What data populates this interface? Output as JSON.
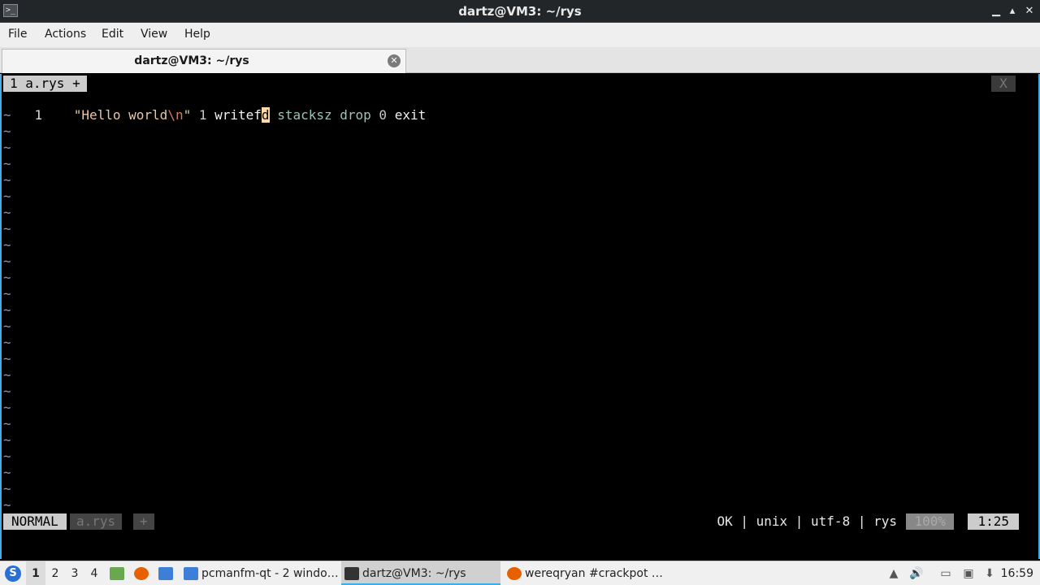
{
  "window": {
    "title": "dartz@VM3: ~/rys",
    "icon": "terminal-icon",
    "buttons": {
      "minimize": "▁",
      "maximize": "▴",
      "close": "✕"
    }
  },
  "menubar": {
    "items": [
      "File",
      "Actions",
      "Edit",
      "View",
      "Help"
    ]
  },
  "tabs": [
    {
      "label": "dartz@VM3: ~/rys",
      "close": "✕"
    }
  ],
  "vim": {
    "tabline": {
      "tab": "1 a.rys +",
      "close": "X"
    },
    "buffer": {
      "line_number": "1",
      "tokens": [
        {
          "text": " \"Hello world",
          "cls": "str"
        },
        {
          "text": "\\n",
          "cls": "esc"
        },
        {
          "text": "\" ",
          "cls": "str"
        },
        {
          "text": "1 ",
          "cls": "num"
        },
        {
          "text": "write",
          "cls": "kw"
        },
        {
          "text": "f",
          "cls": "kw"
        },
        {
          "text": "d",
          "cls": "cursor"
        },
        {
          "text": " stacksz drop ",
          "cls": "kw2"
        },
        {
          "text": "0 ",
          "cls": "num"
        },
        {
          "text": "exit",
          "cls": "kw"
        }
      ],
      "tilde": "~"
    },
    "statusline": {
      "mode": "NORMAL",
      "filename": "a.rys",
      "modified": "+",
      "info": "OK | unix | utf-8 | rys",
      "percent": "100%",
      "position": "1:25"
    }
  },
  "taskbar": {
    "workspaces": [
      "1",
      "2",
      "3",
      "4"
    ],
    "tasks": [
      {
        "label": "pcmanfm-qt - 2 windo…",
        "icon": "folder-icon"
      },
      {
        "label": "dartz@VM3: ~/rys",
        "icon": "terminal-icon"
      },
      {
        "label": "wereqryan #crackpot …",
        "icon": "firefox-icon"
      }
    ],
    "clock": "16:59"
  }
}
